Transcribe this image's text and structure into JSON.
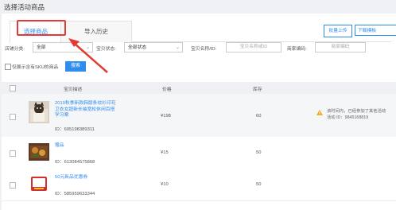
{
  "page": {
    "title": "选择活动商品"
  },
  "tabs": [
    {
      "label": "选择商品"
    },
    {
      "label": "导入历史"
    }
  ],
  "toolbar": {
    "batch_upload": "批量上传",
    "download_template": "下载模板"
  },
  "filters": {
    "shop_category_label": "店铺分类:",
    "shop_category_value": "全部",
    "item_status_label": "宝贝状态:",
    "item_status_value": "全部状态",
    "item_name_label": "宝贝名称/ID:",
    "item_name_placeholder": "宝贝名称或ID",
    "merchant_code_label": "商家编码:",
    "merchant_code_placeholder": "商家编码",
    "sku_only_label": "仅展示含有SKU的商品",
    "search_button": "搜索"
  },
  "table": {
    "headers": {
      "description": "宝贝描述",
      "price": "价格",
      "stock": "库存"
    },
    "rows": [
      {
        "name": "2019秋季新款韩版条纹衫印花卫衣女超新长袖宽松休闲百搭学习案",
        "id": "ID：605198389311",
        "price": "¥198",
        "stock": "60",
        "note_line1": "该时间内，已经参加了其他活动",
        "note_line2": "活动 ID：9845168819",
        "thumb": "cat-shirt"
      },
      {
        "name": "赠品",
        "id": "ID：613084575868",
        "price": "¥15",
        "stock": "50",
        "thumb": "food-box"
      },
      {
        "name": "50元新品优惠券",
        "id": "ID：585959633344",
        "price": "¥10",
        "stock": "50",
        "thumb": "coupon-50"
      }
    ]
  },
  "colors": {
    "accent": "#2d8cf0",
    "highlight": "#e53935",
    "warning": "#f5a623"
  }
}
